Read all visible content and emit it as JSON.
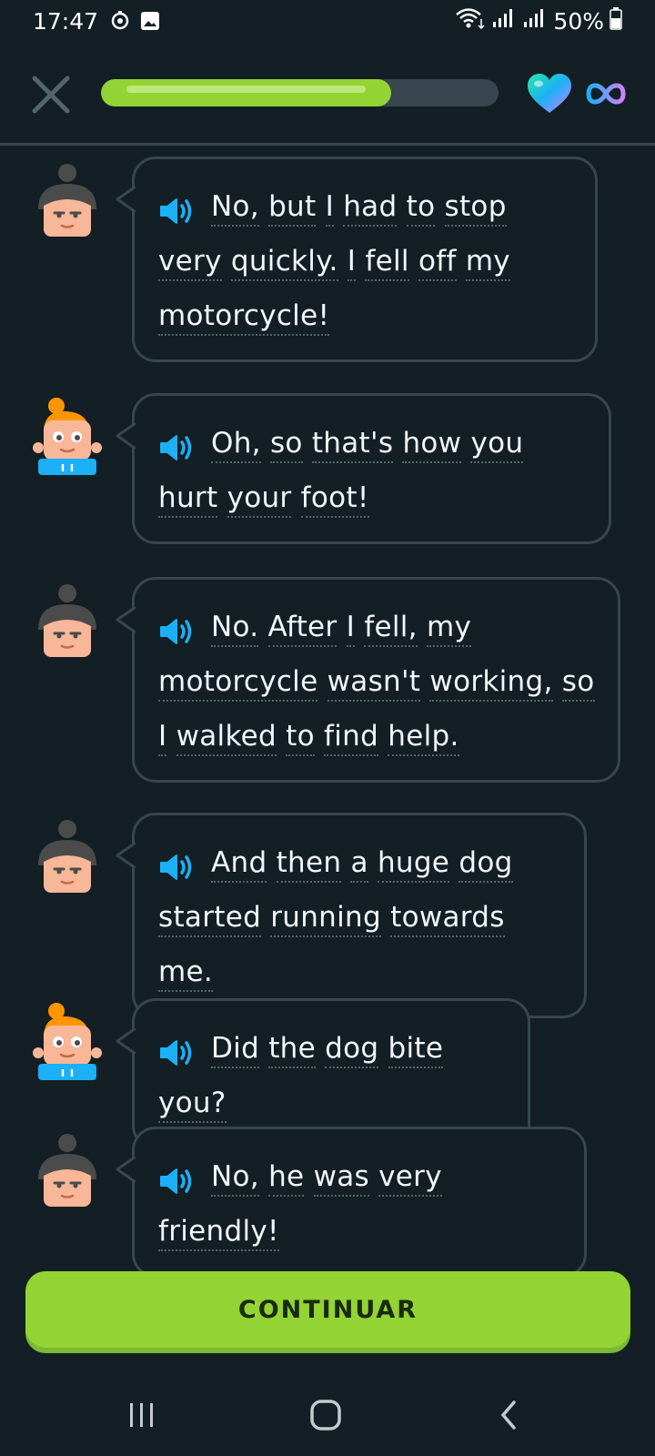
{
  "status_bar": {
    "time": "17:47",
    "battery": "50%",
    "icons": [
      "cast-icon",
      "gallery-icon",
      "wifi-icon",
      "signal-icon",
      "signal-icon",
      "battery-icon"
    ]
  },
  "header": {
    "progress_fraction": 0.73,
    "hearts": "infinite"
  },
  "colors": {
    "background": "#131f24",
    "accent_green": "#93d333",
    "speaker_blue": "#1cb0f6",
    "border": "#37464f"
  },
  "messages": [
    {
      "speaker": "man",
      "text": [
        "No,",
        "but",
        "I",
        "had",
        "to",
        "stop",
        "very",
        "quickly.",
        "I",
        "fell",
        "off",
        "my",
        "motorcycle!"
      ]
    },
    {
      "speaker": "woman",
      "text": [
        "Oh,",
        "so",
        "that's",
        "how",
        "you",
        "hurt",
        "your",
        "foot!"
      ]
    },
    {
      "speaker": "man",
      "text": [
        "No.",
        "After",
        "I",
        "fell,",
        "my",
        "motorcycle",
        "wasn't",
        "working,",
        "so",
        "I",
        "walked",
        "to",
        "find",
        "help."
      ]
    },
    {
      "speaker": "man",
      "text": [
        "And",
        "then",
        "a",
        "huge",
        "dog",
        "started",
        "running",
        "towards",
        "me."
      ]
    },
    {
      "speaker": "woman",
      "text": [
        "Did",
        "the",
        "dog",
        "bite",
        "you?"
      ]
    },
    {
      "speaker": "man",
      "text": [
        "No,",
        "he",
        "was",
        "very",
        "friendly!"
      ]
    }
  ],
  "continue_label": "CONTINUAR",
  "nav": [
    "recents-icon",
    "home-icon",
    "back-icon"
  ]
}
